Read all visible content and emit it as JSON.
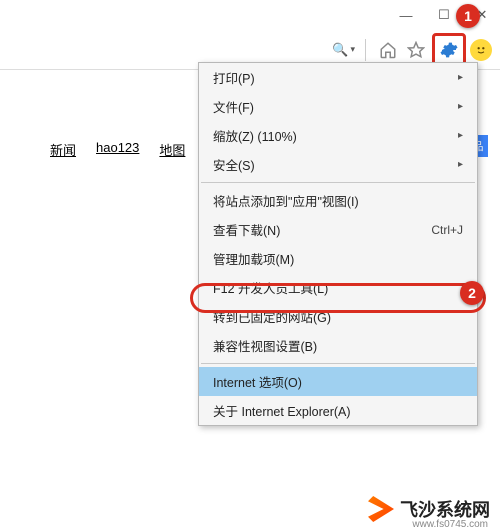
{
  "window_controls": {
    "minimize": "—",
    "maximize": "☐",
    "close": "✕"
  },
  "toolbar": {
    "search_glyph": "🔍",
    "home_icon": "home-icon",
    "star_icon": "favorites-icon",
    "gear_icon": "settings-icon",
    "smiley_icon": "feedback-icon"
  },
  "page": {
    "links": [
      "新闻",
      "hao123",
      "地图"
    ],
    "blue_tag": "品"
  },
  "menu": {
    "items": [
      {
        "label": "打印(P)",
        "has_sub": true
      },
      {
        "label": "文件(F)",
        "has_sub": true
      },
      {
        "label": "缩放(Z) (110%)",
        "has_sub": true
      },
      {
        "label": "安全(S)",
        "has_sub": true
      },
      {
        "sep": true
      },
      {
        "label": "将站点添加到\"应用\"视图(I)"
      },
      {
        "label": "查看下载(N)",
        "shortcut": "Ctrl+J"
      },
      {
        "label": "管理加载项(M)"
      },
      {
        "label": "F12 开发人员工具(L)"
      },
      {
        "label": "转到已固定的网站(G)"
      },
      {
        "label": "兼容性视图设置(B)"
      },
      {
        "sep": true
      },
      {
        "label": "Internet 选项(O)",
        "highlighted": true
      },
      {
        "label": "关于 Internet Explorer(A)"
      }
    ]
  },
  "callouts": {
    "one": "1",
    "two": "2"
  },
  "watermark": {
    "brand": "飞沙系统网",
    "url": "www.fs0745.com"
  }
}
